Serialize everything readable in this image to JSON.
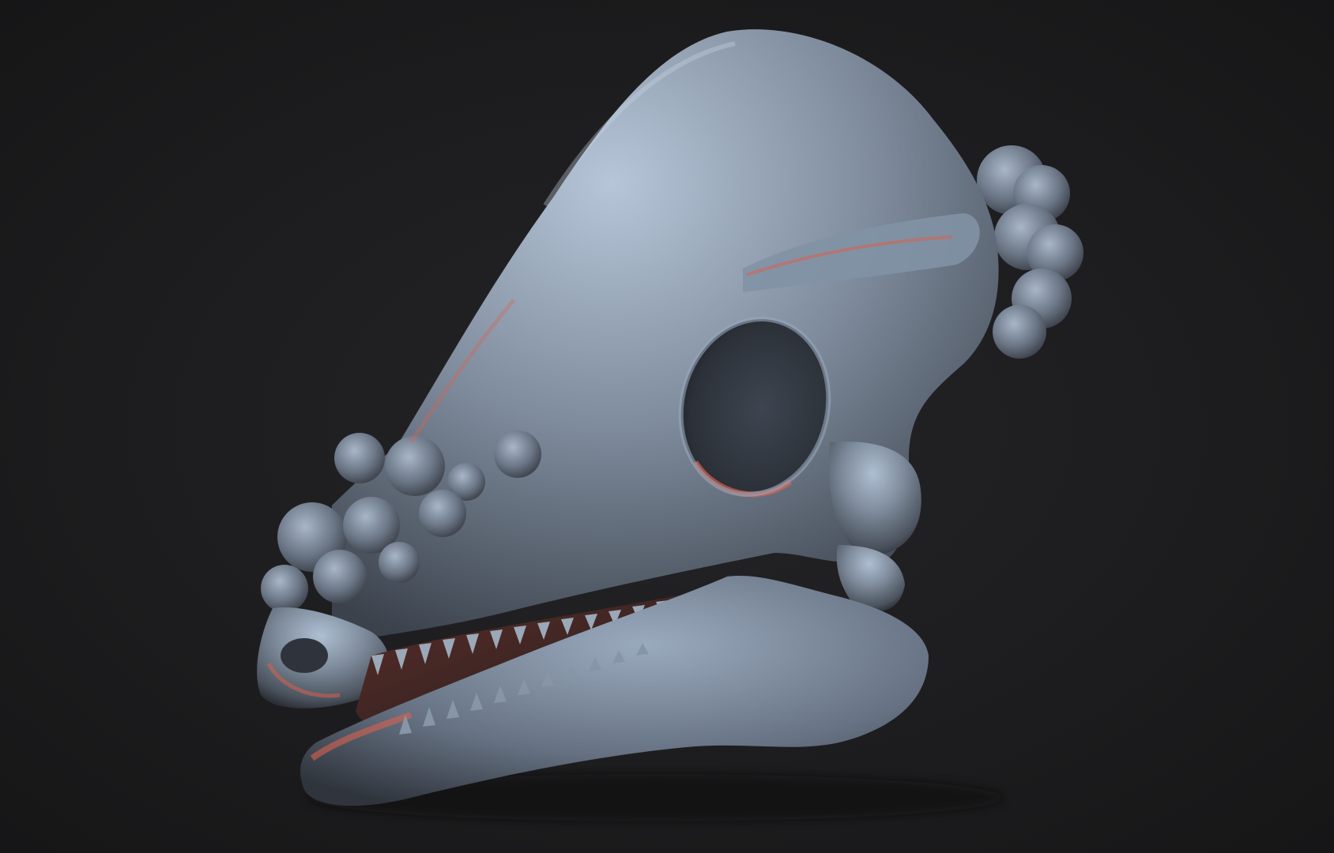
{
  "scene": {
    "subject": "pachycephalosaur-skull-sculpt",
    "colors": {
      "background": "#1b1b1c",
      "bone_base": "#6f7b8a",
      "bone_highlight": "#aebfd2",
      "bone_shadow": "#2b2f36",
      "rim_light": "#d9614f"
    }
  }
}
